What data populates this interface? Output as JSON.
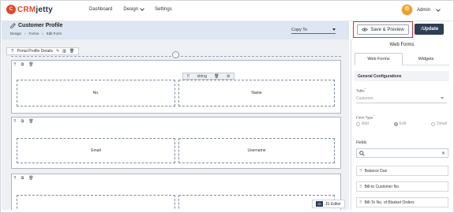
{
  "brand": {
    "crm": "CRM",
    "name": "jetty"
  },
  "nav": {
    "dashboard": "Dashboard",
    "design": "Design",
    "settings": "Settings"
  },
  "user": {
    "name": "Admin"
  },
  "header": {
    "title": "Customer Profile",
    "breadcrumb": [
      "Design",
      "Forms",
      "Edit Form"
    ],
    "copy_to": "Copy To"
  },
  "actions": {
    "save_preview": "Save & Preview",
    "update": "Update"
  },
  "canvas": {
    "section_title": "Portal Profile Details",
    "field_type": "string",
    "fields": {
      "no": "No.",
      "name": "Name",
      "email": "Email",
      "username": "Username"
    },
    "js_editor": "JS Editor"
  },
  "panel": {
    "title": "Web Forms",
    "tabs": [
      "Web Forms",
      "Widgets"
    ],
    "general_config": "General Configurations",
    "table_label": "Table",
    "table_value": "Customer",
    "form_type_label": "Form Type",
    "form_types": [
      "Add",
      "Edit",
      "Detail"
    ],
    "selected_form_type": "Edit",
    "fields_label": "Fields",
    "field_items": [
      "Balance Due",
      "Bill-to Customer No.",
      "Bill-To No. of Blanket Orders"
    ]
  },
  "colors": {
    "brand": "#e0482b",
    "update_bg": "#2d3e55",
    "highlight": "#e0302a",
    "header_bg": "#dde6f2"
  }
}
